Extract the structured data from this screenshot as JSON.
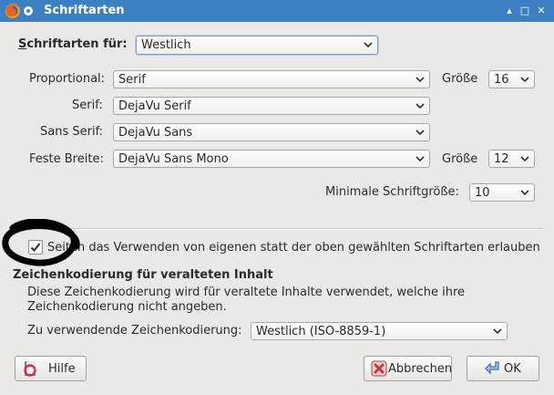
{
  "window": {
    "title": "Schriftarten",
    "controls": [
      "▴",
      "□",
      "✕"
    ]
  },
  "fonts_for": {
    "label": "Schriftarten für:",
    "value": "Westlich"
  },
  "rows": {
    "proportional": {
      "label": "Proportional:",
      "value": "Serif",
      "size_label": "Größe",
      "size_value": "16"
    },
    "serif": {
      "label": "Serif:",
      "value": "DejaVu Serif"
    },
    "sans_serif": {
      "label": "Sans Serif:",
      "value": "DejaVu Sans"
    },
    "monospace": {
      "label": "Feste Breite:",
      "value": "DejaVu Sans Mono",
      "size_label": "Größe",
      "size_value": "12"
    }
  },
  "min_size": {
    "label": "Minimale Schriftgröße:",
    "value": "10"
  },
  "allow_page_fonts": {
    "checked": true,
    "label": "Seiten das Verwenden von eigenen statt der oben gewählten Schriftarten erlauben"
  },
  "encoding": {
    "heading": "Zeichenkodierung für veralteten Inhalt",
    "description_line1": "Diese Zeichenkodierung wird für veraltete Inhalte verwendet, welche ihre",
    "description_line2": "Zeichenkodierung nicht angeben.",
    "label": "Zu verwendende Zeichenkodierung:",
    "value": "Westlich (ISO-8859-1)"
  },
  "buttons": {
    "help": "Hilfe",
    "cancel": "Abbrechen",
    "ok": "OK"
  },
  "icons": {
    "app": "firefox-icon",
    "menu": "window-menu-icon",
    "help": "help-book-icon",
    "cancel": "cancel-x-icon",
    "ok": "ok-arrow-icon"
  },
  "colors": {
    "titlebar": "#3c7fc3",
    "dialog_bg": "#eae9e7",
    "annotation": "#000000"
  }
}
